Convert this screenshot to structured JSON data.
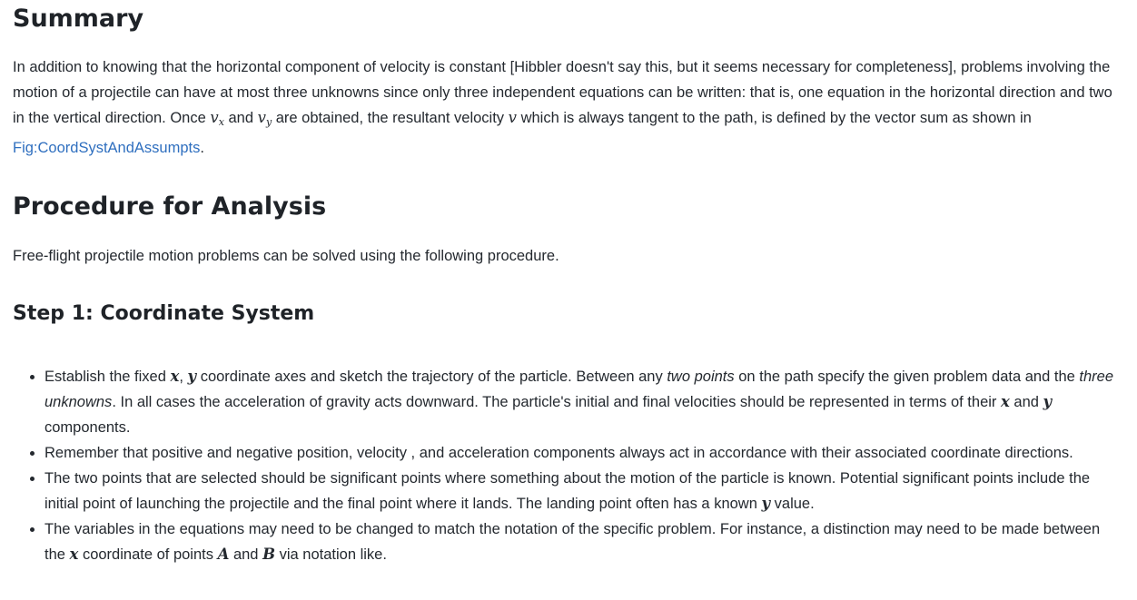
{
  "summary": {
    "title": "Summary",
    "p1_a": "In addition to knowing that the horizontal component of velocity is constant [Hibbler doesn't say this, but it seems necessary for completeness], problems involving the motion of a projectile can have at most three unknowns since only three independent equations can be written: that is, one equation in the horizontal direction and two in the vertical direction. Once ",
    "vx_base": "v",
    "vx_sub": "x",
    "p1_b": " and ",
    "vy_base": "v",
    "vy_sub": "y",
    "p1_c": " are obtained, the resultant velocity ",
    "v": "v",
    "p1_d": " which is always tangent to the path, is defined by the vector sum as shown in ",
    "link": "Fig:CoordSystAndAssumpts",
    "p1_e": "."
  },
  "procedure": {
    "title": "Procedure for Analysis",
    "intro": "Free-flight projectile motion problems can be solved using the following procedure."
  },
  "step1": {
    "title": "Step 1: Coordinate System",
    "b1_a": "Establish the fixed ",
    "b1_x": "x",
    "b1_comma": ", ",
    "b1_y": "y",
    "b1_b": " coordinate axes and sketch the trajectory of the particle. Between any ",
    "b1_em1": "two points",
    "b1_c": " on the path specify the given problem data and the ",
    "b1_em2": "three unknowns",
    "b1_d": ". In all cases the acceleration of gravity acts downward. The particle's initial and final velocities should be represented in terms of their ",
    "b1_x2": "x",
    "b1_and": " and ",
    "b1_y2": "y",
    "b1_e": " components.",
    "b2": "Remember that positive and negative position, velocity , and acceleration components always act in accordance with their associated coordinate directions.",
    "b3_a": "The two points that are selected should be significant points where something about the motion of the particle is known. Potential significant points include the initial point of launching the projectile and the final point where it lands. The landing point often has a known ",
    "b3_y": "y",
    "b3_b": " value.",
    "b4_a": "The variables in the equations may need to be changed to match the notation of the specific problem. For instance, a distinction may need to be made between the ",
    "b4_x": "x",
    "b4_b": " coordinate of points ",
    "b4_A": "A",
    "b4_and": " and ",
    "b4_B": "B",
    "b4_c": " via notation like."
  }
}
